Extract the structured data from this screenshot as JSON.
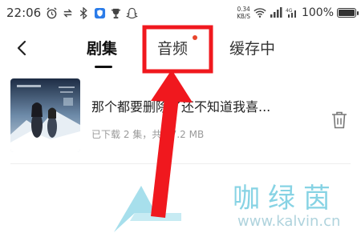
{
  "status_bar": {
    "time": "22:06",
    "net_speed_value": "0.34",
    "net_speed_unit": "KB/S",
    "battery_text": "100%",
    "battery_level": 1.0
  },
  "tabs": [
    {
      "label": "剧集",
      "active": true
    },
    {
      "label": "音频",
      "active": false,
      "has_badge": true
    },
    {
      "label": "缓存中",
      "active": false
    }
  ],
  "downloads": [
    {
      "title": "那个都要删除了还不知道我喜...",
      "subtitle": "已下载 2 集，共 47.2 MB"
    }
  ],
  "watermark": {
    "name": "咖绿茵",
    "url": "www.kalvin.cn"
  },
  "colors": {
    "annotation_red": "#f0181e",
    "badge_red": "#e8452c",
    "watermark_blue": "#5fc5dc"
  }
}
